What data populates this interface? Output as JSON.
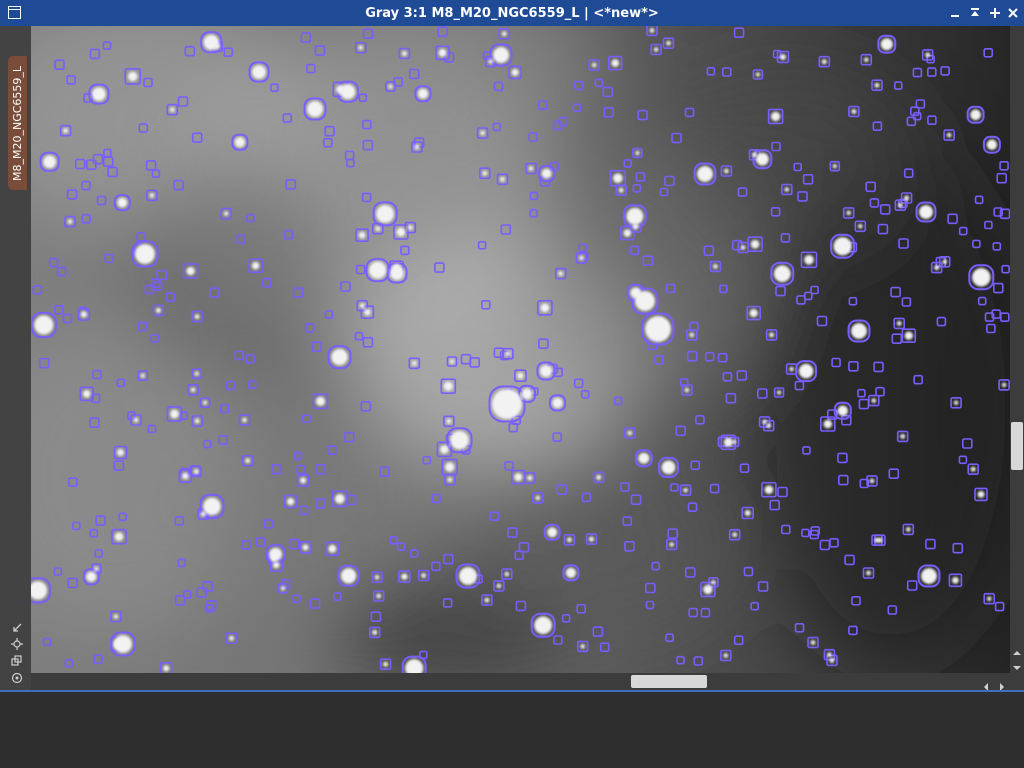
{
  "window": {
    "title": "Gray 3:1 M8_M20_NGC6559_L | <*new*>",
    "controls": [
      "window-menu-icon",
      "minimize-icon",
      "shade-icon",
      "maximize-icon",
      "close-icon"
    ]
  },
  "view_tab": {
    "label": "M8_M20_NGC6559_L"
  },
  "side_tools": [
    "zoom-fit-icon",
    "crosshair-icon",
    "clone-view-icon",
    "target-icon"
  ],
  "image": {
    "description_kind": "grayscale nebula star field with star detection outlines",
    "outline_color": "#7a5cff"
  },
  "scrollbars": {
    "horizontal_position": 0.63,
    "vertical_position": 0.61
  }
}
